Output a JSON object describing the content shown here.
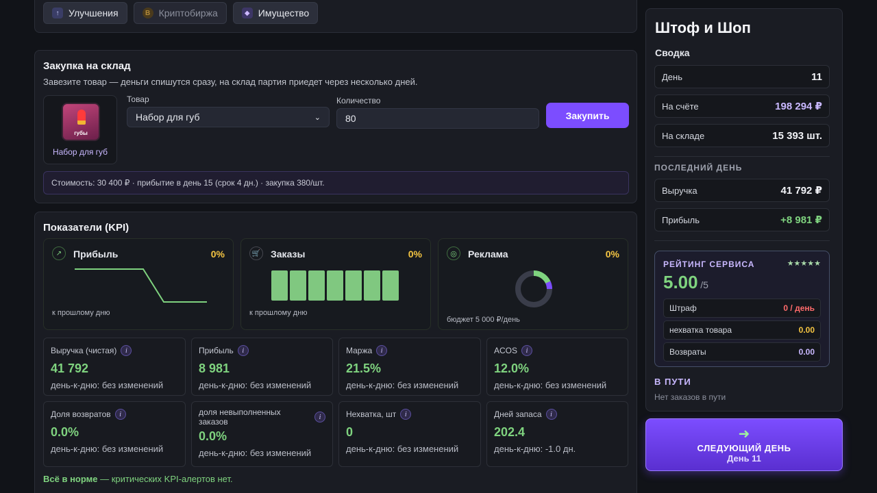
{
  "top_tabs": [
    {
      "label": "Улучшения",
      "icon": "↑"
    },
    {
      "label": "Криптобиржа",
      "icon": "B"
    },
    {
      "label": "Имущество",
      "icon": "◆"
    }
  ],
  "purchase": {
    "title": "Закупка на склад",
    "description": "Завезите товар — деньги спишутся сразу, на склад партия приедет через несколько дней.",
    "product_badge": "губы",
    "product_name": "Набор для губ",
    "product_label": "Товар",
    "product_value": "Набор для губ",
    "qty_label": "Количество",
    "qty_value": "80",
    "buy_label": "Закупить",
    "summary": "Стоимость: 30 400 ₽ · прибытие в день 15 (срок 4 дн.) · закупка 380/шт."
  },
  "kpi": {
    "title": "Показатели (KPI)",
    "cards": [
      {
        "title": "Прибыль",
        "pct": "0%",
        "icon": "↗",
        "footer": "к прошлому дню"
      },
      {
        "title": "Заказы",
        "pct": "0%",
        "icon": "🛒",
        "footer": "к прошлому дню"
      },
      {
        "title": "Реклама",
        "pct": "0%",
        "icon": "◎",
        "footer": "бюджет 5 000 ₽/день"
      }
    ],
    "profit_line": [
      0,
      0,
      0,
      0,
      1,
      1,
      1
    ],
    "order_bars": [
      1,
      1,
      1,
      1,
      1,
      1,
      1
    ],
    "ad_donut": {
      "green": 0.18,
      "purple": 0.07
    },
    "metrics": [
      {
        "label": "Выручка (чистая)",
        "value": "41 792",
        "sub": "день-к-дню: без изменений"
      },
      {
        "label": "Прибыль",
        "value": "8 981",
        "sub": "день-к-дню: без изменений"
      },
      {
        "label": "Маржа",
        "value": "21.5%",
        "sub": "день-к-дню: без изменений"
      },
      {
        "label": "ACOS",
        "value": "12.0%",
        "sub": "день-к-дню: без изменений"
      },
      {
        "label": "Доля возвратов",
        "value": "0.0%",
        "sub": "день-к-дню: без изменений"
      },
      {
        "label": "доля невыполненных заказов",
        "value": "0.0%",
        "sub": "день-к-дню: без изменений"
      },
      {
        "label": "Нехватка, шт",
        "value": "0",
        "sub": "день-к-дню: без изменений"
      },
      {
        "label": "Дней запаса",
        "value": "202.4",
        "sub": "день-к-дню: -1.0 дн."
      }
    ],
    "alert_strong": "Всё в норме",
    "alert_rest": " — критических KPI-алертов нет."
  },
  "sidebar": {
    "title": "Штоф и Шоп",
    "summary_title": "Сводка",
    "summary": [
      {
        "k": "День",
        "v": "11"
      },
      {
        "k": "На счёте",
        "v": "198 294 ₽"
      },
      {
        "k": "На складе",
        "v": "15 393 шт."
      }
    ],
    "last_day_title": "ПОСЛЕДНИЙ ДЕНЬ",
    "last_day": [
      {
        "k": "Выручка",
        "v": "41 792 ₽"
      },
      {
        "k": "Прибыль",
        "v": "+8 981 ₽"
      }
    ],
    "rating": {
      "title": "РЕЙТИНГ СЕРВИСА",
      "stars": "★★★★★",
      "value": "5.00",
      "max": "/5",
      "rows": [
        {
          "k": "Штраф",
          "v": "0 / день"
        },
        {
          "k": "нехватка товара",
          "v": "0.00"
        },
        {
          "k": "Возвраты",
          "v": "0.00"
        }
      ]
    },
    "transit_title": "В ПУТИ",
    "transit_text": "Нет заказов в пути"
  },
  "next_day": {
    "arrow": "➜",
    "label": "СЛЕДУЮЩИЙ ДЕНЬ",
    "sub": "День 11"
  },
  "colors": {
    "accent": "#7c4dff",
    "green": "#7fd37f",
    "yellow": "#f5c542",
    "red": "#ff6b6b"
  }
}
